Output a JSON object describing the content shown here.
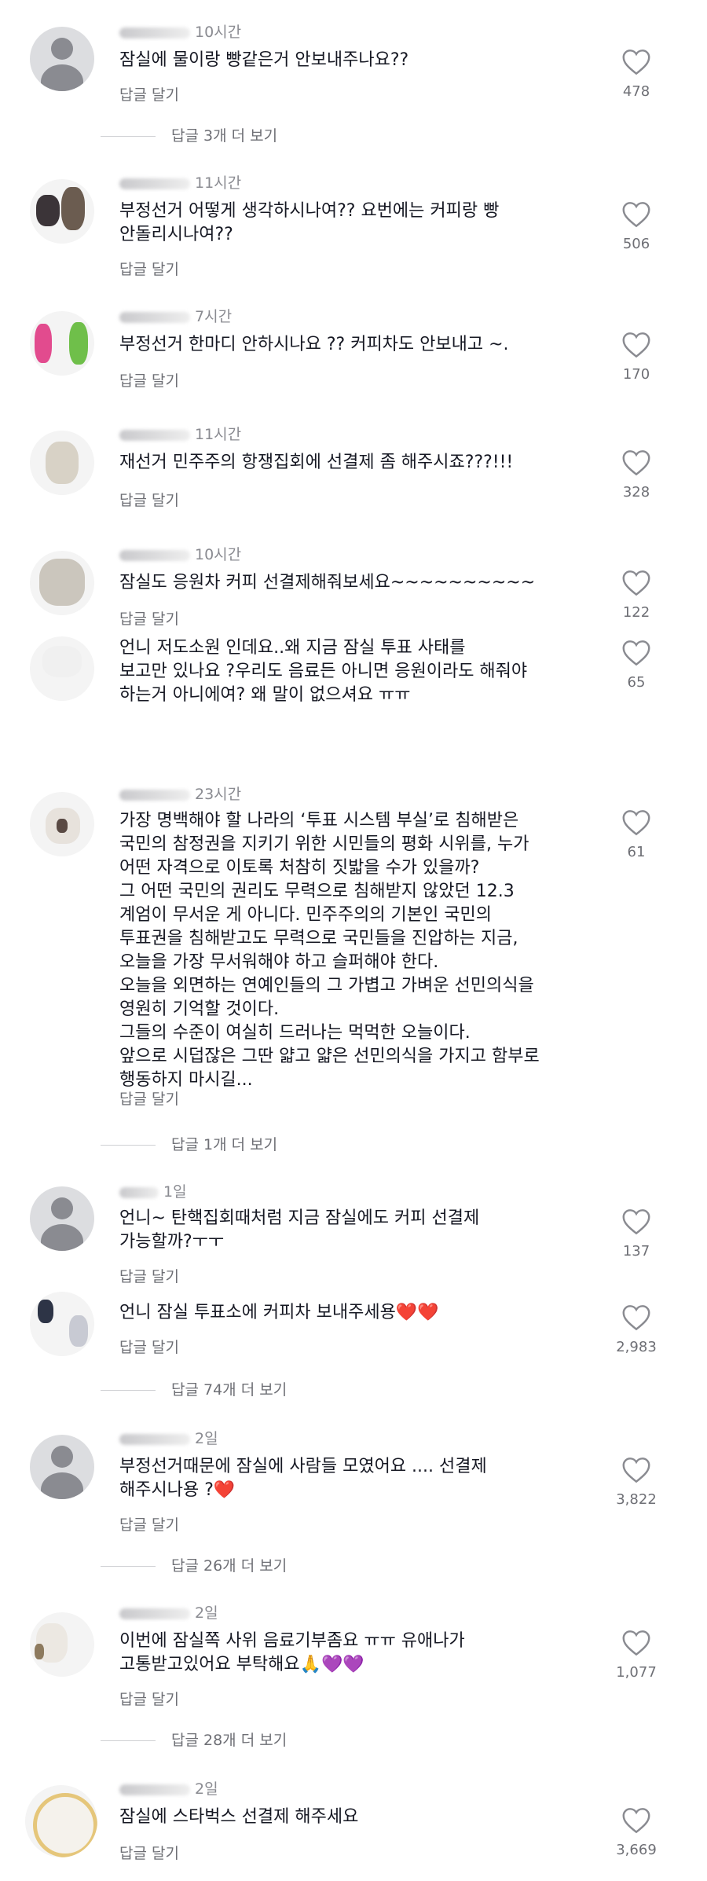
{
  "comments": [
    {
      "time": "10시간",
      "text": "잠실에 물이랑 빵같은거 안보내주나요??",
      "reply": "답글 달기",
      "likes": "478"
    },
    {
      "time": "11시간",
      "text": "부정선거 어떻게 생각하시나여?? 요번에는 커피랑 빵\n안돌리시나여??",
      "reply": "답글 달기",
      "likes": "506"
    },
    {
      "time": "7시간",
      "text": "부정선거 한마디 안하시나요 ?? 커피차도 안보내고 ~.",
      "reply": "답글 달기",
      "likes": "170"
    },
    {
      "time": "11시간",
      "text": "재선거 민주주의 항쟁집회에 선결제 좀 해주시죠???!!!",
      "reply": "답글 달기",
      "likes": "328"
    },
    {
      "time": "10시간",
      "text": "잠실도 응원차 커피 선결제해줘보세요~~~~~~~~~~",
      "reply": "답글 달기",
      "likes": "122"
    },
    {
      "time": "",
      "text": "언니 저도소원 인데요..왜 지금 잠실 투표 사태를\n보고만 있나요 ?우리도 음료든  아니면 응원이라도 해줘야\n하는거 아니에여? 왜 말이 없으셔요 ㅠㅠ",
      "reply": "",
      "likes": "65"
    },
    {
      "time": "23시간",
      "text": "가장 명백해야 할 나라의 ‘투표 시스템 부실’로 침해받은\n국민의 참정권을 지키기 위한 시민들의 평화 시위를, 누가\n어떤 자격으로 이토록 처참히 짓밟을 수가 있을까?\n그 어떤 국민의 권리도 무력으로 침해받지 않았던 12.3\n계엄이 무서운 게 아니다. 민주주의의 기본인 국민의\n투표권을 침해받고도 무력으로 국민들을 진압하는 지금,\n오늘을 가장 무서워해야 하고 슬퍼해야 한다.\n오늘을 외면하는 연예인들의 그 가볍고 가벼운 선민의식을\n영원히 기억할 것이다.\n그들의 수준이 여실히 드러나는 먹먹한 오늘이다.\n앞으로 시덥잖은 그딴 얇고 얇은 선민의식을 가지고 함부로\n행동하지 마시길...",
      "reply": "답글 달기",
      "likes": "61"
    },
    {
      "time": "1일",
      "text": "언니~ 탄핵집회때처럼 지금 잠실에도 커피 선결제\n가능할까?ㅜㅜ",
      "reply": "답글 달기",
      "likes": "137"
    },
    {
      "time": "",
      "text": "언니 잠실 투표소에 커피차 보내주세용",
      "emoji": "❤️❤️",
      "reply": "답글 달기",
      "likes": "2,983"
    },
    {
      "time": "2일",
      "text": "부정선거때문에 잠실에 사람들 모였어요 .... 선결제\n해주시나용 ?",
      "emoji": "❤️",
      "reply": "답글 달기",
      "likes": "3,822"
    },
    {
      "time": "2일",
      "text": "이번에 잠실쪽 사위 음료기부좀요 ㅠㅠ 유애나가\n고통받고있어요 부탁해요",
      "emoji": "🙏💜💜",
      "reply": "답글 달기",
      "likes": "1,077"
    },
    {
      "time": "2일",
      "text": "잠실에 스타벅스 선결제 해주세요",
      "reply": "답글 달기",
      "likes": "3,669"
    }
  ],
  "more_replies": [
    "답글 3개 더 보기",
    "답글 1개 더 보기",
    "답글 74개 더 보기",
    "답글 26개 더 보기",
    "답글 28개 더 보기"
  ]
}
